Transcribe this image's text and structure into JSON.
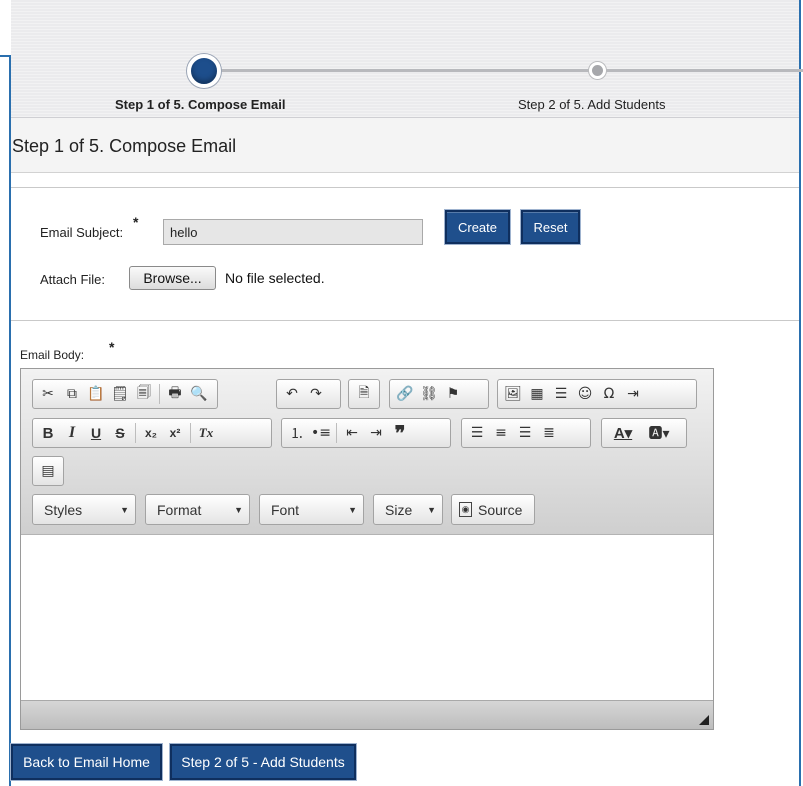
{
  "wizard": {
    "step1_label": "Step 1 of 5. Compose Email",
    "step2_label": "Step 2 of 5. Add Students"
  },
  "section_title": "Step 1 of 5. Compose Email",
  "form": {
    "subject_label": "Email Subject:",
    "required_mark": "*",
    "subject_value": "hello",
    "create_label": "Create",
    "reset_label": "Reset",
    "attach_label": "Attach File:",
    "browse_label": "Browse...",
    "file_status": "No file selected.",
    "body_label": "Email Body:"
  },
  "editor": {
    "styles_label": "Styles",
    "format_label": "Format",
    "font_label": "Font",
    "size_label": "Size",
    "source_label": "Source",
    "toolbar_row1": {
      "group1": [
        "cut-icon",
        "copy-icon",
        "paste-icon",
        "paste-text-icon",
        "paste-word-icon",
        "print-icon",
        "preview-icon"
      ],
      "group2": [
        "undo-icon",
        "redo-icon"
      ],
      "group3": [
        "templates-icon"
      ],
      "group4": [
        "link-icon",
        "unlink-icon",
        "anchor-icon"
      ],
      "group5": [
        "image-icon",
        "table-icon",
        "horizontal-rule-icon",
        "smiley-icon",
        "special-char-icon",
        "page-break-icon"
      ]
    },
    "toolbar_row2": {
      "bold": "B",
      "italic": "I",
      "underline": "U",
      "strike": "S",
      "subscript": "x₂",
      "superscript": "x²",
      "remove_format": "Tx"
    }
  },
  "buttons": {
    "back_label": "Back to Email Home",
    "next_label": "Step 2 of 5 - Add Students"
  },
  "colors": {
    "primary_button": "#1f4f8c",
    "frame_border": "#2a6fae"
  }
}
